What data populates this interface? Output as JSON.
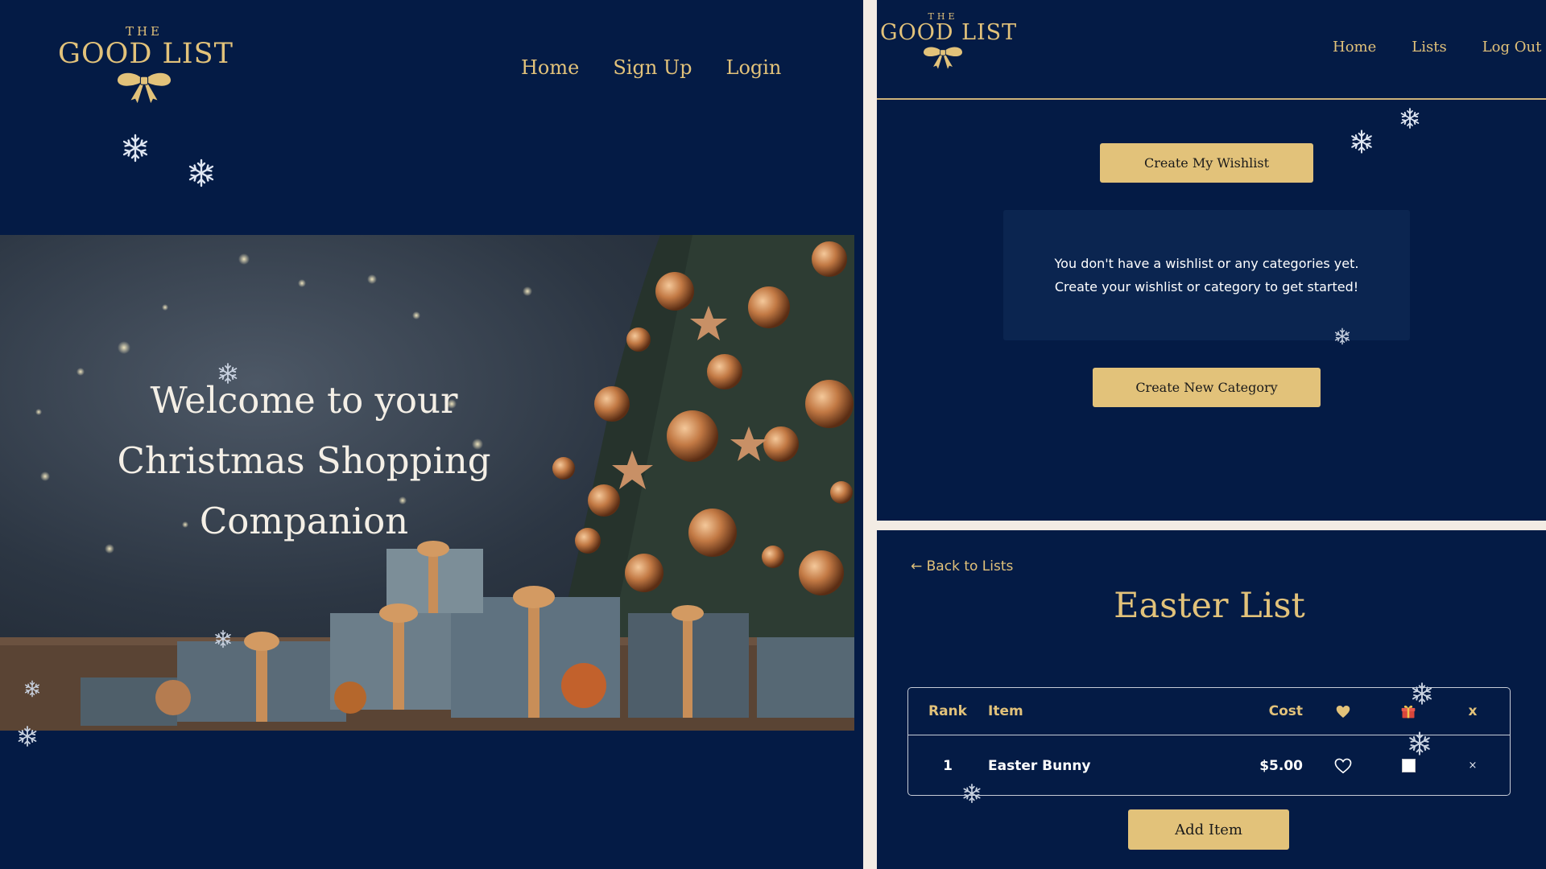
{
  "logo": {
    "the": "THE",
    "name": "GOOD LIST"
  },
  "landing": {
    "nav": [
      "Home",
      "Sign Up",
      "Login"
    ],
    "hero_title_lines": [
      "Welcome to your",
      "Christmas Shopping",
      "Companion"
    ]
  },
  "dashboard": {
    "nav": [
      "Home",
      "Lists",
      "Log Out"
    ],
    "create_wishlist_label": "Create My Wishlist",
    "empty_line_1": "You don't have a wishlist or any categories yet.",
    "empty_line_2": "Create your wishlist or category to get started!",
    "create_category_label": "Create New Category"
  },
  "list_page": {
    "back_label": "← Back to Lists",
    "title": "Easter List",
    "columns": {
      "rank": "Rank",
      "item": "Item",
      "cost": "Cost",
      "delete": "x"
    },
    "rows": [
      {
        "rank": "1",
        "item": "Easter Bunny",
        "cost": "$5.00",
        "delete": "×"
      }
    ],
    "add_item_label": "Add Item"
  },
  "colors": {
    "navy": "#041b45",
    "gold": "#e2c27a",
    "card": "#0b2550"
  }
}
